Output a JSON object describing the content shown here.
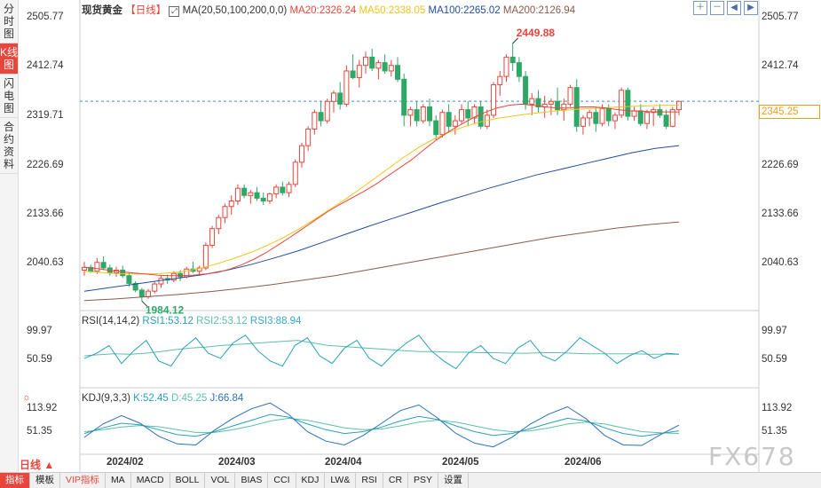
{
  "sidebar": {
    "items": [
      {
        "label": "分时图",
        "active": false
      },
      {
        "label": "K线图",
        "active": true
      },
      {
        "label": "闪电图",
        "active": false
      },
      {
        "label": "合约资料",
        "active": false
      }
    ]
  },
  "price_header": {
    "name": "现货黄金",
    "period": "【日线】",
    "ma_label": "MA(20,50,100,200,0,0)",
    "ma20": "MA20:2326.24",
    "ma50": "MA50:2338.05",
    "ma100": "MA100:2265.02",
    "ma200": "MA200:2126.94"
  },
  "rsi_header": {
    "label": "RSI(14,14,2)",
    "rsi1": "RSI1:53.12",
    "rsi2": "RSI2:53.12",
    "rsi3": "RSI3:88.94"
  },
  "kdj_header": {
    "label": "KDJ(9,3,3)",
    "k": "K:52.45",
    "d": "D:45.25",
    "j": "J:66.84"
  },
  "y_axis": {
    "price_ticks": [
      "2505.77",
      "2412.74",
      "2319.71",
      "2226.69",
      "2133.66",
      "2040.63"
    ],
    "rsi_ticks": [
      "99.97",
      "50.59"
    ],
    "kdj_ticks": [
      "113.92",
      "51.35"
    ]
  },
  "x_axis": {
    "labels": [
      "2024/02",
      "2024/03",
      "2024/04",
      "2024/05",
      "2024/06"
    ]
  },
  "current_price": "2345.25",
  "high_label": "2449.88",
  "low_label": "1984.12",
  "period_button": "日线",
  "bottom_tabs": [
    "指标",
    "模板",
    "VIP指标",
    "MA",
    "MACD",
    "BOLL",
    "VOL",
    "BIAS",
    "CCI",
    "KDJ",
    "LW&",
    "RSI",
    "CR",
    "PSY",
    "设置"
  ],
  "watermark": "FX678",
  "colors": {
    "up": "#e8453c",
    "down": "#2fa866",
    "ma20": "#e8453c",
    "ma50": "#f0c419",
    "ma100": "#1f4e9e",
    "ma200": "#8b5a4a",
    "rsi1": "#2a9fb8",
    "rsi2": "#5cc0a8",
    "rsi3": "#38a8c8"
  },
  "chart_data": {
    "type": "candlestick",
    "ylim": [
      1975,
      2505.77
    ],
    "x_labels": [
      "2024/02",
      "2024/03",
      "2024/04",
      "2024/05",
      "2024/06"
    ],
    "candles": [
      [
        2040,
        2055,
        2030,
        2045
      ],
      [
        2045,
        2050,
        2035,
        2038
      ],
      [
        2038,
        2062,
        2033,
        2054
      ],
      [
        2054,
        2065,
        2040,
        2044
      ],
      [
        2044,
        2050,
        2030,
        2035
      ],
      [
        2035,
        2046,
        2028,
        2040
      ],
      [
        2040,
        2048,
        2026,
        2030
      ],
      [
        2030,
        2036,
        2010,
        2016
      ],
      [
        2016,
        2020,
        2000,
        2004
      ],
      [
        2004,
        2008,
        1984,
        1992
      ],
      [
        1992,
        2006,
        1988,
        2002
      ],
      [
        2002,
        2020,
        1998,
        2015
      ],
      [
        2015,
        2030,
        2008,
        2025
      ],
      [
        2025,
        2032,
        2015,
        2022
      ],
      [
        2022,
        2038,
        2018,
        2034
      ],
      [
        2034,
        2040,
        2020,
        2028
      ],
      [
        2028,
        2046,
        2025,
        2042
      ],
      [
        2042,
        2055,
        2035,
        2038
      ],
      [
        2038,
        2048,
        2030,
        2044
      ],
      [
        2044,
        2090,
        2040,
        2085
      ],
      [
        2085,
        2120,
        2080,
        2115
      ],
      [
        2115,
        2140,
        2105,
        2135
      ],
      [
        2135,
        2160,
        2125,
        2155
      ],
      [
        2155,
        2175,
        2140,
        2165
      ],
      [
        2165,
        2195,
        2158,
        2188
      ],
      [
        2188,
        2195,
        2170,
        2175
      ],
      [
        2175,
        2185,
        2160,
        2180
      ],
      [
        2180,
        2190,
        2165,
        2170
      ],
      [
        2170,
        2180,
        2158,
        2165
      ],
      [
        2165,
        2180,
        2160,
        2178
      ],
      [
        2178,
        2195,
        2170,
        2190
      ],
      [
        2190,
        2200,
        2175,
        2180
      ],
      [
        2180,
        2200,
        2172,
        2195
      ],
      [
        2195,
        2240,
        2190,
        2235
      ],
      [
        2235,
        2270,
        2225,
        2265
      ],
      [
        2265,
        2300,
        2255,
        2295
      ],
      [
        2295,
        2330,
        2285,
        2325
      ],
      [
        2325,
        2345,
        2300,
        2310
      ],
      [
        2310,
        2350,
        2305,
        2345
      ],
      [
        2345,
        2365,
        2325,
        2360
      ],
      [
        2360,
        2380,
        2330,
        2340
      ],
      [
        2340,
        2410,
        2335,
        2400
      ],
      [
        2400,
        2430,
        2385,
        2388
      ],
      [
        2388,
        2420,
        2370,
        2410
      ],
      [
        2410,
        2435,
        2395,
        2425
      ],
      [
        2425,
        2440,
        2400,
        2405
      ],
      [
        2405,
        2420,
        2385,
        2415
      ],
      [
        2415,
        2430,
        2395,
        2400
      ],
      [
        2400,
        2420,
        2390,
        2410
      ],
      [
        2410,
        2425,
        2380,
        2385
      ],
      [
        2385,
        2395,
        2300,
        2320
      ],
      [
        2320,
        2335,
        2300,
        2330
      ],
      [
        2330,
        2345,
        2300,
        2310
      ],
      [
        2310,
        2340,
        2305,
        2335
      ],
      [
        2335,
        2350,
        2300,
        2310
      ],
      [
        2310,
        2320,
        2275,
        2285
      ],
      [
        2285,
        2330,
        2280,
        2325
      ],
      [
        2325,
        2340,
        2290,
        2300
      ],
      [
        2300,
        2320,
        2285,
        2310
      ],
      [
        2310,
        2340,
        2305,
        2330
      ],
      [
        2330,
        2345,
        2300,
        2315
      ],
      [
        2315,
        2340,
        2305,
        2335
      ],
      [
        2335,
        2345,
        2295,
        2300
      ],
      [
        2300,
        2330,
        2295,
        2320
      ],
      [
        2320,
        2380,
        2315,
        2375
      ],
      [
        2375,
        2400,
        2355,
        2390
      ],
      [
        2390,
        2430,
        2380,
        2425
      ],
      [
        2425,
        2450,
        2400,
        2415
      ],
      [
        2415,
        2425,
        2380,
        2390
      ],
      [
        2390,
        2400,
        2330,
        2340
      ],
      [
        2340,
        2360,
        2320,
        2350
      ],
      [
        2350,
        2365,
        2325,
        2335
      ],
      [
        2335,
        2355,
        2315,
        2340
      ],
      [
        2340,
        2350,
        2320,
        2345
      ],
      [
        2345,
        2370,
        2320,
        2330
      ],
      [
        2330,
        2350,
        2310,
        2340
      ],
      [
        2340,
        2375,
        2335,
        2370
      ],
      [
        2370,
        2385,
        2290,
        2300
      ],
      [
        2300,
        2320,
        2285,
        2315
      ],
      [
        2315,
        2330,
        2300,
        2325
      ],
      [
        2325,
        2335,
        2290,
        2305
      ],
      [
        2305,
        2340,
        2300,
        2332
      ],
      [
        2332,
        2340,
        2300,
        2310
      ],
      [
        2310,
        2325,
        2295,
        2320
      ],
      [
        2320,
        2370,
        2315,
        2365
      ],
      [
        2365,
        2370,
        2310,
        2318
      ],
      [
        2318,
        2335,
        2310,
        2328
      ],
      [
        2328,
        2340,
        2300,
        2305
      ],
      [
        2305,
        2330,
        2295,
        2325
      ],
      [
        2325,
        2335,
        2300,
        2330
      ],
      [
        2330,
        2340,
        2315,
        2320
      ],
      [
        2320,
        2330,
        2295,
        2300
      ],
      [
        2300,
        2335,
        2298,
        2330
      ],
      [
        2330,
        2345,
        2320,
        2345
      ]
    ],
    "ma20": [
      2045,
      2043,
      2040,
      2037,
      2035,
      2033,
      2031,
      2030,
      2030,
      2031,
      2033,
      2036,
      2042,
      2050,
      2060,
      2072,
      2086,
      2100,
      2115,
      2130,
      2145,
      2158,
      2170,
      2182,
      2195,
      2210,
      2225,
      2240,
      2258,
      2275,
      2290,
      2303,
      2315,
      2325,
      2333,
      2338,
      2340,
      2338,
      2335,
      2333,
      2333,
      2335,
      2335,
      2333,
      2330,
      2328,
      2327,
      2326,
      2326,
      2326
    ],
    "ma50": [
      2038,
      2036,
      2034,
      2033,
      2033,
      2034,
      2036,
      2040,
      2046,
      2054,
      2063,
      2073,
      2085,
      2098,
      2113,
      2130,
      2148,
      2166,
      2185,
      2205,
      2225,
      2245,
      2263,
      2278,
      2290,
      2300,
      2308,
      2314,
      2318,
      2322,
      2325,
      2328,
      2330,
      2332,
      2333,
      2335,
      2336,
      2337,
      2338,
      2338
    ],
    "ma100": [
      2002,
      2008,
      2014,
      2020,
      2026,
      2032,
      2040,
      2050,
      2062,
      2075,
      2090,
      2105,
      2120,
      2134,
      2148,
      2162,
      2175,
      2188,
      2200,
      2212,
      2222,
      2232,
      2242,
      2252,
      2260,
      2265
    ],
    "ma200": [
      1985,
      1988,
      1992,
      1996,
      2001,
      2007,
      2014,
      2022,
      2030,
      2040,
      2050,
      2060,
      2070,
      2080,
      2090,
      2100,
      2108,
      2116,
      2122,
      2127
    ],
    "rsi1": [
      45,
      55,
      70,
      35,
      60,
      80,
      40,
      30,
      65,
      85,
      55,
      45,
      75,
      90,
      60,
      40,
      30,
      70,
      85,
      50,
      35,
      65,
      80,
      45,
      30,
      55,
      75,
      90,
      60,
      40,
      25,
      55,
      70,
      45,
      35,
      65,
      80,
      50,
      40,
      60,
      85,
      70,
      55,
      35,
      50,
      60,
      45,
      55,
      53
    ],
    "rsi2": [
      50,
      52,
      54,
      53,
      55,
      58,
      62,
      65,
      67,
      70,
      72,
      74,
      76,
      78,
      80,
      75,
      70,
      68,
      66,
      64,
      62,
      60,
      58,
      58,
      57,
      57,
      56,
      56,
      55,
      55,
      56,
      56,
      55,
      54,
      54,
      54,
      54,
      53,
      53,
      53
    ],
    "kdj_k": [
      45,
      60,
      72,
      68,
      55,
      42,
      38,
      50,
      65,
      80,
      95,
      88,
      70,
      55,
      45,
      50,
      62,
      78,
      90,
      82,
      65,
      50,
      40,
      45,
      58,
      72,
      85,
      78,
      60,
      45,
      38,
      45,
      52
    ],
    "kdj_d": [
      50,
      55,
      62,
      66,
      63,
      55,
      48,
      48,
      55,
      65,
      78,
      85,
      80,
      70,
      60,
      55,
      57,
      65,
      75,
      80,
      75,
      65,
      55,
      50,
      52,
      60,
      70,
      75,
      70,
      60,
      50,
      47,
      45
    ],
    "kdj_j": [
      35,
      70,
      92,
      72,
      38,
      18,
      15,
      54,
      85,
      110,
      125,
      95,
      50,
      25,
      15,
      40,
      72,
      105,
      120,
      86,
      45,
      20,
      10,
      35,
      70,
      96,
      115,
      84,
      40,
      15,
      14,
      42,
      67
    ]
  }
}
